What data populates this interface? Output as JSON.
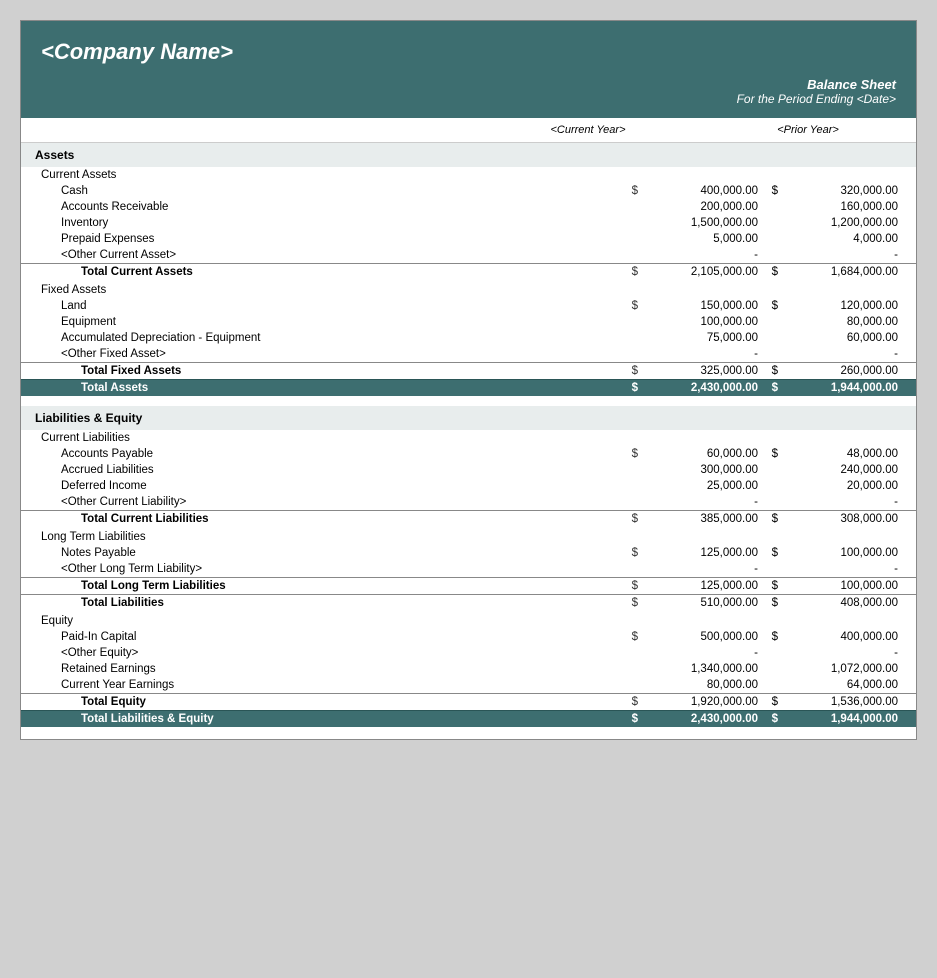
{
  "header": {
    "company_name": "<Company Name>",
    "title": "Balance Sheet",
    "subtitle": "For the Period Ending <Date>",
    "col_cy": "<Current Year>",
    "col_py": "<Prior Year>"
  },
  "assets": {
    "section_label": "Assets",
    "current_assets": {
      "label": "Current Assets",
      "items": [
        {
          "label": "Cash",
          "sign_cy": "$",
          "cy": "400,000.00",
          "sign_py": "$",
          "py": "320,000.00"
        },
        {
          "label": "Accounts Receivable",
          "sign_cy": "",
          "cy": "200,000.00",
          "sign_py": "",
          "py": "160,000.00"
        },
        {
          "label": "Inventory",
          "sign_cy": "",
          "cy": "1,500,000.00",
          "sign_py": "",
          "py": "1,200,000.00"
        },
        {
          "label": "Prepaid Expenses",
          "sign_cy": "",
          "cy": "5,000.00",
          "sign_py": "",
          "py": "4,000.00"
        },
        {
          "label": "<Other Current Asset>",
          "sign_cy": "",
          "cy": "-",
          "sign_py": "",
          "py": "-"
        }
      ],
      "total_label": "Total Current Assets",
      "total_sign_cy": "$",
      "total_cy": "2,105,000.00",
      "total_sign_py": "$",
      "total_py": "1,684,000.00"
    },
    "fixed_assets": {
      "label": "Fixed Assets",
      "items": [
        {
          "label": "Land",
          "sign_cy": "$",
          "cy": "150,000.00",
          "sign_py": "$",
          "py": "120,000.00"
        },
        {
          "label": "Equipment",
          "sign_cy": "",
          "cy": "100,000.00",
          "sign_py": "",
          "py": "80,000.00"
        },
        {
          "label": "Accumulated Depreciation - Equipment",
          "sign_cy": "",
          "cy": "75,000.00",
          "sign_py": "",
          "py": "60,000.00"
        },
        {
          "label": "<Other Fixed Asset>",
          "sign_cy": "",
          "cy": "-",
          "sign_py": "",
          "py": "-"
        }
      ],
      "total_label": "Total Fixed Assets",
      "total_sign_cy": "$",
      "total_cy": "325,000.00",
      "total_sign_py": "$",
      "total_py": "260,000.00"
    },
    "grand_total_label": "Total Assets",
    "grand_total_sign_cy": "$",
    "grand_total_cy": "2,430,000.00",
    "grand_total_sign_py": "$",
    "grand_total_py": "1,944,000.00"
  },
  "liabilities_equity": {
    "section_label": "Liabilities & Equity",
    "current_liabilities": {
      "label": "Current Liabilities",
      "items": [
        {
          "label": "Accounts Payable",
          "sign_cy": "$",
          "cy": "60,000.00",
          "sign_py": "$",
          "py": "48,000.00"
        },
        {
          "label": "Accrued Liabilities",
          "sign_cy": "",
          "cy": "300,000.00",
          "sign_py": "",
          "py": "240,000.00"
        },
        {
          "label": "Deferred Income",
          "sign_cy": "",
          "cy": "25,000.00",
          "sign_py": "",
          "py": "20,000.00"
        },
        {
          "label": "<Other Current Liability>",
          "sign_cy": "",
          "cy": "-",
          "sign_py": "",
          "py": "-"
        }
      ],
      "total_label": "Total Current Liabilities",
      "total_sign_cy": "$",
      "total_cy": "385,000.00",
      "total_sign_py": "$",
      "total_py": "308,000.00"
    },
    "long_term_liabilities": {
      "label": "Long Term Liabilities",
      "items": [
        {
          "label": "Notes Payable",
          "sign_cy": "$",
          "cy": "125,000.00",
          "sign_py": "$",
          "py": "100,000.00"
        },
        {
          "label": "<Other Long Term Liability>",
          "sign_cy": "",
          "cy": "-",
          "sign_py": "",
          "py": "-"
        }
      ],
      "total_label": "Total Long Term Liabilities",
      "total_sign_cy": "$",
      "total_cy": "125,000.00",
      "total_sign_py": "$",
      "total_py": "100,000.00",
      "total_liabilities_label": "Total Liabilities",
      "total_liabilities_sign_cy": "$",
      "total_liabilities_cy": "510,000.00",
      "total_liabilities_sign_py": "$",
      "total_liabilities_py": "408,000.00"
    },
    "equity": {
      "label": "Equity",
      "items": [
        {
          "label": "Paid-In Capital",
          "sign_cy": "$",
          "cy": "500,000.00",
          "sign_py": "$",
          "py": "400,000.00"
        },
        {
          "label": "<Other Equity>",
          "sign_cy": "",
          "cy": "-",
          "sign_py": "",
          "py": "-"
        },
        {
          "label": "Retained Earnings",
          "sign_cy": "",
          "cy": "1,340,000.00",
          "sign_py": "",
          "py": "1,072,000.00"
        },
        {
          "label": "Current Year Earnings",
          "sign_cy": "",
          "cy": "80,000.00",
          "sign_py": "",
          "py": "64,000.00"
        }
      ],
      "total_label": "Total Equity",
      "total_sign_cy": "$",
      "total_cy": "1,920,000.00",
      "total_sign_py": "$",
      "total_py": "1,536,000.00"
    },
    "grand_total_label": "Total Liabilities & Equity",
    "grand_total_sign_cy": "$",
    "grand_total_cy": "2,430,000.00",
    "grand_total_sign_py": "$",
    "grand_total_py": "1,944,000.00"
  }
}
